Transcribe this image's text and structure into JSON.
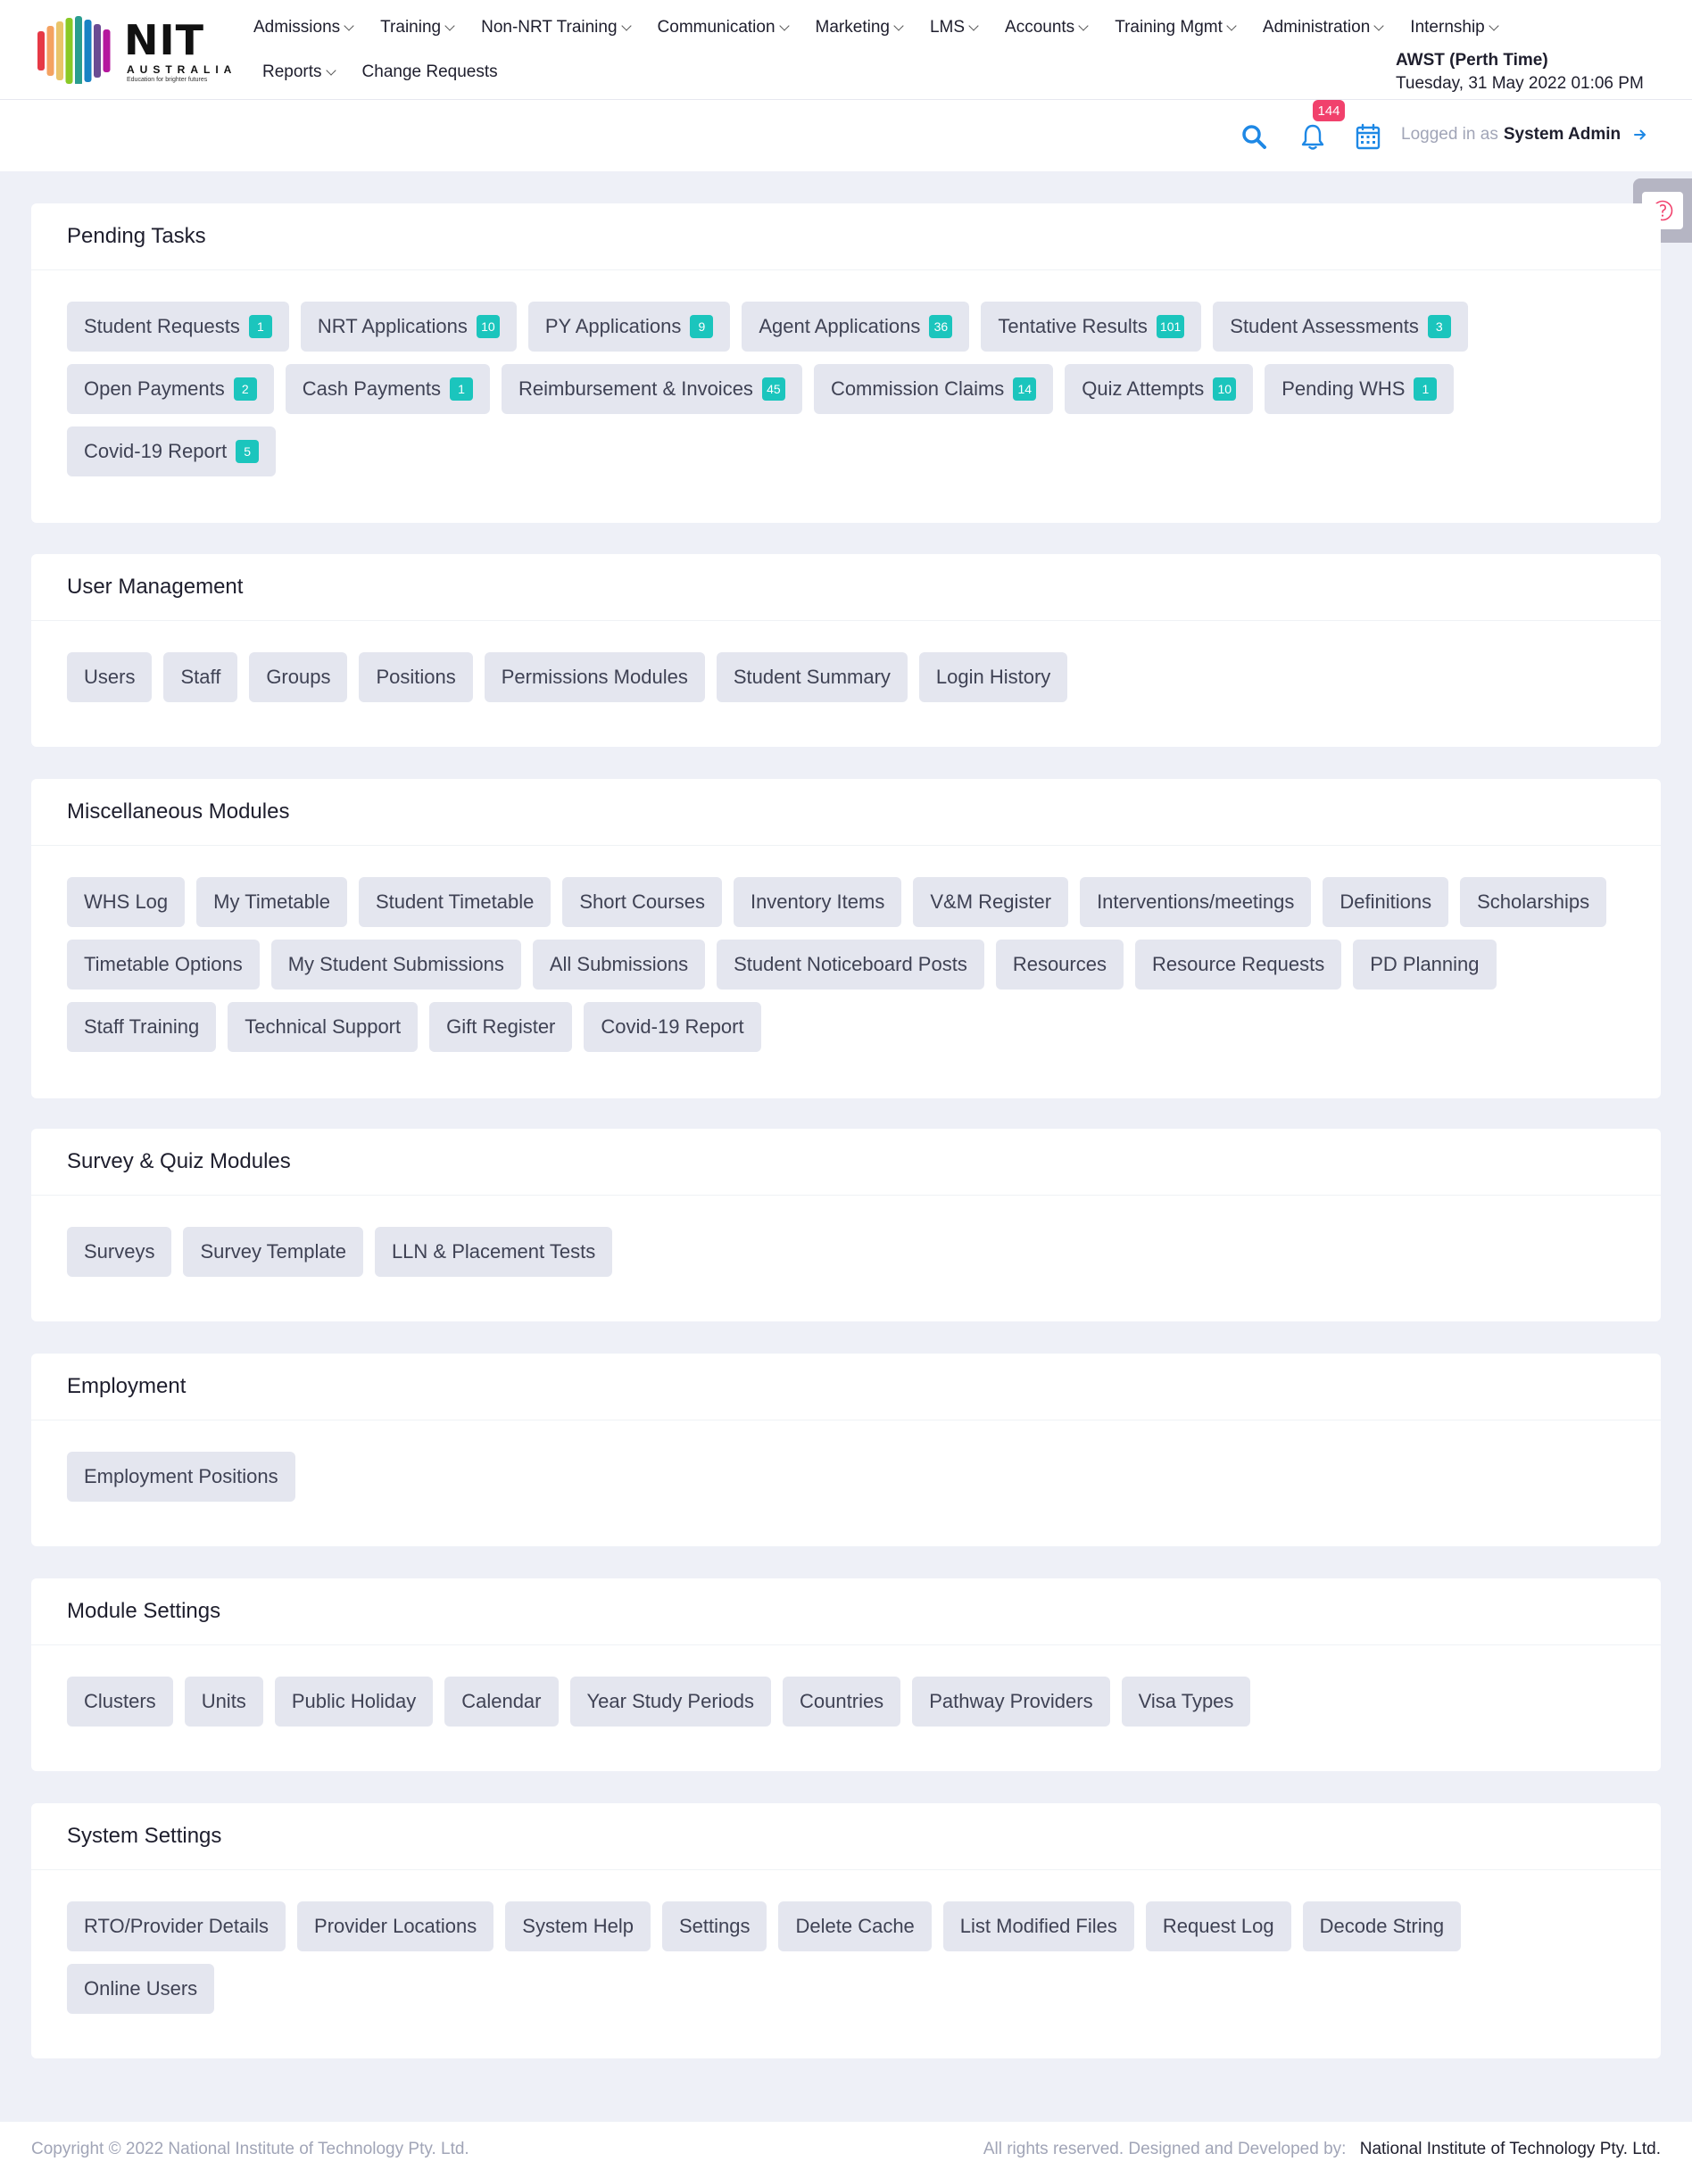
{
  "brand": {
    "name": "NIT",
    "sub": "AUSTRALIA",
    "tagline": "Education for brighter futures",
    "bar_colors": [
      "#e63946",
      "#f4a261",
      "#e9c46a",
      "#8ac926",
      "#2a9d8f",
      "#1982c4",
      "#6a4c93",
      "#b5179e"
    ]
  },
  "nav": {
    "row1": [
      {
        "label": "Admissions",
        "dropdown": true
      },
      {
        "label": "Training",
        "dropdown": true
      },
      {
        "label": "Non-NRT Training",
        "dropdown": true
      },
      {
        "label": "Communication",
        "dropdown": true
      },
      {
        "label": "Marketing",
        "dropdown": true
      },
      {
        "label": "LMS",
        "dropdown": true
      },
      {
        "label": "Accounts",
        "dropdown": true
      },
      {
        "label": "Training Mgmt",
        "dropdown": true
      },
      {
        "label": "Administration",
        "dropdown": true
      },
      {
        "label": "Internship",
        "dropdown": true
      }
    ],
    "row2": [
      {
        "label": "Reports",
        "dropdown": true
      },
      {
        "label": "Change Requests",
        "dropdown": false
      }
    ]
  },
  "timezone": {
    "label": "AWST (Perth Time)",
    "datetime": "Tuesday, 31 May 2022 01:06 PM"
  },
  "toolbar": {
    "notification_count": "144",
    "logged_prefix": "Logged in as",
    "user_name": "System Admin",
    "accent_color": "#1e88e5"
  },
  "sections": [
    {
      "title": "Pending Tasks",
      "items": [
        {
          "label": "Student Requests",
          "count": "1"
        },
        {
          "label": "NRT Applications",
          "count": "10"
        },
        {
          "label": "PY Applications",
          "count": "9"
        },
        {
          "label": "Agent Applications",
          "count": "36"
        },
        {
          "label": "Tentative Results",
          "count": "101"
        },
        {
          "label": "Student Assessments",
          "count": "3"
        },
        {
          "label": "Open Payments",
          "count": "2"
        },
        {
          "label": "Cash Payments",
          "count": "1"
        },
        {
          "label": "Reimbursement & Invoices",
          "count": "45"
        },
        {
          "label": "Commission Claims",
          "count": "14"
        },
        {
          "label": "Quiz Attempts",
          "count": "10"
        },
        {
          "label": "Pending WHS",
          "count": "1"
        },
        {
          "label": "Covid-19 Report",
          "count": "5"
        }
      ]
    },
    {
      "title": "User Management",
      "items": [
        {
          "label": "Users"
        },
        {
          "label": "Staff"
        },
        {
          "label": "Groups"
        },
        {
          "label": "Positions"
        },
        {
          "label": "Permissions Modules"
        },
        {
          "label": "Student Summary"
        },
        {
          "label": "Login History"
        }
      ]
    },
    {
      "title": "Miscellaneous Modules",
      "items": [
        {
          "label": "WHS Log"
        },
        {
          "label": "My Timetable"
        },
        {
          "label": "Student Timetable"
        },
        {
          "label": "Short Courses"
        },
        {
          "label": "Inventory Items"
        },
        {
          "label": "V&M Register"
        },
        {
          "label": "Interventions/meetings"
        },
        {
          "label": "Definitions"
        },
        {
          "label": "Scholarships"
        },
        {
          "label": "Timetable Options"
        },
        {
          "label": "My Student Submissions"
        },
        {
          "label": "All Submissions"
        },
        {
          "label": "Student Noticeboard Posts"
        },
        {
          "label": "Resources"
        },
        {
          "label": "Resource Requests"
        },
        {
          "label": "PD Planning"
        },
        {
          "label": "Staff Training"
        },
        {
          "label": "Technical Support"
        },
        {
          "label": "Gift Register"
        },
        {
          "label": "Covid-19 Report"
        }
      ]
    },
    {
      "title": "Survey & Quiz Modules",
      "items": [
        {
          "label": "Surveys"
        },
        {
          "label": "Survey Template"
        },
        {
          "label": "LLN & Placement Tests"
        }
      ]
    },
    {
      "title": "Employment",
      "items": [
        {
          "label": "Employment Positions"
        }
      ]
    },
    {
      "title": "Module Settings",
      "items": [
        {
          "label": "Clusters"
        },
        {
          "label": "Units"
        },
        {
          "label": "Public Holiday"
        },
        {
          "label": "Calendar"
        },
        {
          "label": "Year Study Periods"
        },
        {
          "label": "Countries"
        },
        {
          "label": "Pathway Providers"
        },
        {
          "label": "Visa Types"
        }
      ]
    },
    {
      "title": "System Settings",
      "items": [
        {
          "label": "RTO/Provider Details"
        },
        {
          "label": "Provider Locations"
        },
        {
          "label": "System Help"
        },
        {
          "label": "Settings"
        },
        {
          "label": "Delete Cache"
        },
        {
          "label": "List Modified Files"
        },
        {
          "label": "Request Log"
        },
        {
          "label": "Decode String"
        },
        {
          "label": "Online Users"
        }
      ]
    }
  ],
  "footer": {
    "copyright": "Copyright © 2022 National Institute of Technology Pty. Ltd.",
    "rights": "All rights reserved. Designed and Developed by:",
    "company": "National Institute of Technology Pty. Ltd."
  }
}
